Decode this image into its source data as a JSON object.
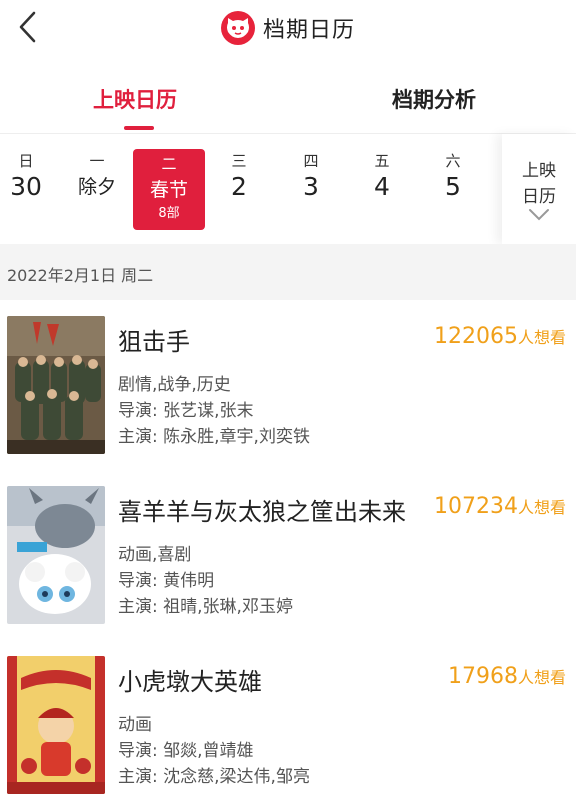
{
  "header": {
    "title": "档期日历",
    "back_icon": "chevron-left-icon",
    "logo_icon": "cat-logo-icon",
    "accent": "#e01f3d"
  },
  "tabs": [
    {
      "label": "上映日历",
      "active": true
    },
    {
      "label": "档期分析",
      "active": false
    }
  ],
  "week": [
    {
      "weekday": "日",
      "day": "30"
    },
    {
      "weekday": "一",
      "day": "除夕"
    },
    {
      "weekday": "二",
      "day": "春节",
      "count": "8部",
      "selected": true
    },
    {
      "weekday": "三",
      "day": "2"
    },
    {
      "weekday": "四",
      "day": "3"
    },
    {
      "weekday": "五",
      "day": "4"
    },
    {
      "weekday": "六",
      "day": "5"
    }
  ],
  "calendar_button": {
    "line1": "上映",
    "line2": "日历",
    "icon": "chevron-down-icon"
  },
  "date_header": "2022年2月1日 周二",
  "movies": [
    {
      "title": "狙击手",
      "want_count": "122065",
      "want_label": "人想看",
      "genres": "剧情,战争,历史",
      "director": "导演: 张艺谋,张末",
      "cast": "主演: 陈永胜,章宇,刘奕铁"
    },
    {
      "title": "喜羊羊与灰太狼之筐出未来",
      "want_count": "107234",
      "want_label": "人想看",
      "genres": "动画,喜剧",
      "director": "导演: 黄伟明",
      "cast": "主演: 祖晴,张琳,邓玉婷"
    },
    {
      "title": "小虎墩大英雄",
      "want_count": "17968",
      "want_label": "人想看",
      "genres": "动画",
      "director": "导演: 邹燚,曾靖雄",
      "cast": "主演: 沈念慈,梁达伟,邹亮"
    }
  ]
}
